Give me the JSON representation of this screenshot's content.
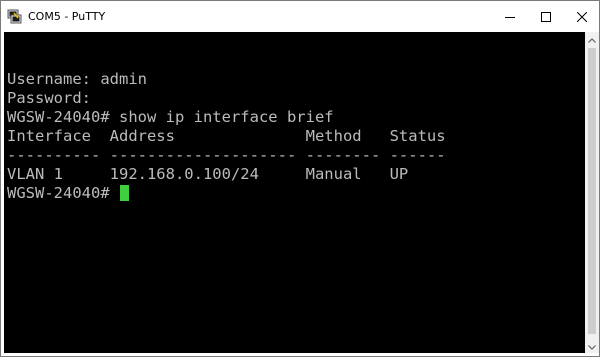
{
  "window": {
    "title": "COM5 - PuTTY",
    "icon": "putty-icon",
    "controls": {
      "minimize": "minimize-icon",
      "maximize": "maximize-icon",
      "close": "close-icon"
    }
  },
  "terminal": {
    "lines": [
      "Username: admin",
      "Password:",
      "WGSW-24040# show ip interface brief",
      "Interface  Address              Method   Status",
      "---------- -------------------- -------- ------",
      "VLAN 1     192.168.0.100/24     Manual   UP"
    ],
    "prompt": "WGSW-24040# ",
    "colors": {
      "background": "#000000",
      "foreground": "#bbbbbb",
      "cursor": "#3fcf3f"
    }
  }
}
